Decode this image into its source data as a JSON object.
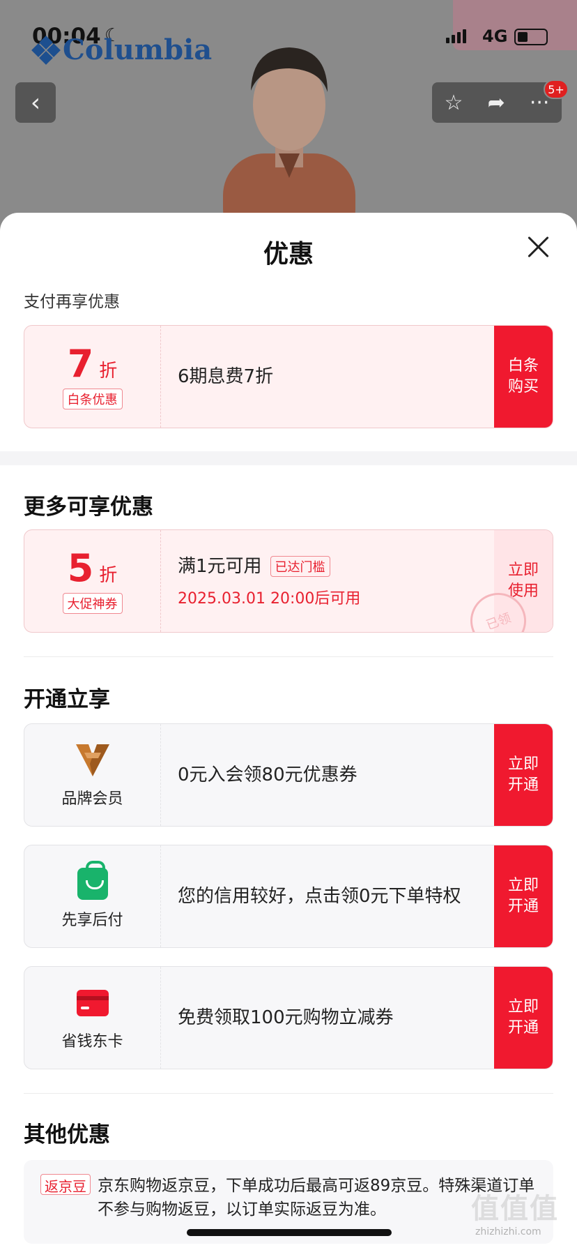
{
  "status": {
    "time": "00:04",
    "network": "4G"
  },
  "product_header": {
    "brand": "Columbia",
    "badge": "5+"
  },
  "sheet": {
    "title": "优惠",
    "pay_section": {
      "subtitle": "支付再享优惠",
      "coupon": {
        "value": "7",
        "unit": "折",
        "tag": "白条优惠",
        "desc": "6期息费7折",
        "action": "白条购买"
      }
    },
    "more_section": {
      "heading": "更多可享优惠",
      "coupon": {
        "value": "5",
        "unit": "折",
        "tag": "大促神券",
        "desc": "满1元可用",
        "status": "已达门槛",
        "time": "2025.03.01 20:00后可用",
        "action": "立即使用",
        "stamp": "已领"
      }
    },
    "open_section": {
      "heading": "开通立享",
      "items": [
        {
          "name": "品牌会员",
          "icon": "brand-member-icon",
          "desc": "0元入会领80元优惠券",
          "action": "立即开通"
        },
        {
          "name": "先享后付",
          "icon": "shopping-bag-icon",
          "desc": "您的信用较好，点击领0元下单特权",
          "action": "立即开通"
        },
        {
          "name": "省钱东卡",
          "icon": "card-icon",
          "desc": "免费领取100元购物立减券",
          "action": "立即开通"
        }
      ]
    },
    "other_section": {
      "heading": "其他优惠",
      "tag": "返京豆",
      "text": "京东购物返京豆，下单成功后最高可返89京豆。特殊渠道订单不参与购物返豆，以订单实际返豆为准。"
    }
  },
  "watermark": {
    "mark": "值值值",
    "url": "zhizhizhi.com"
  },
  "colors": {
    "accent": "#f0192f",
    "accent_text": "#e8202f",
    "pink_bg": "#fff1f2",
    "green": "#19b36b",
    "brand_blue": "#1f4f8e"
  }
}
